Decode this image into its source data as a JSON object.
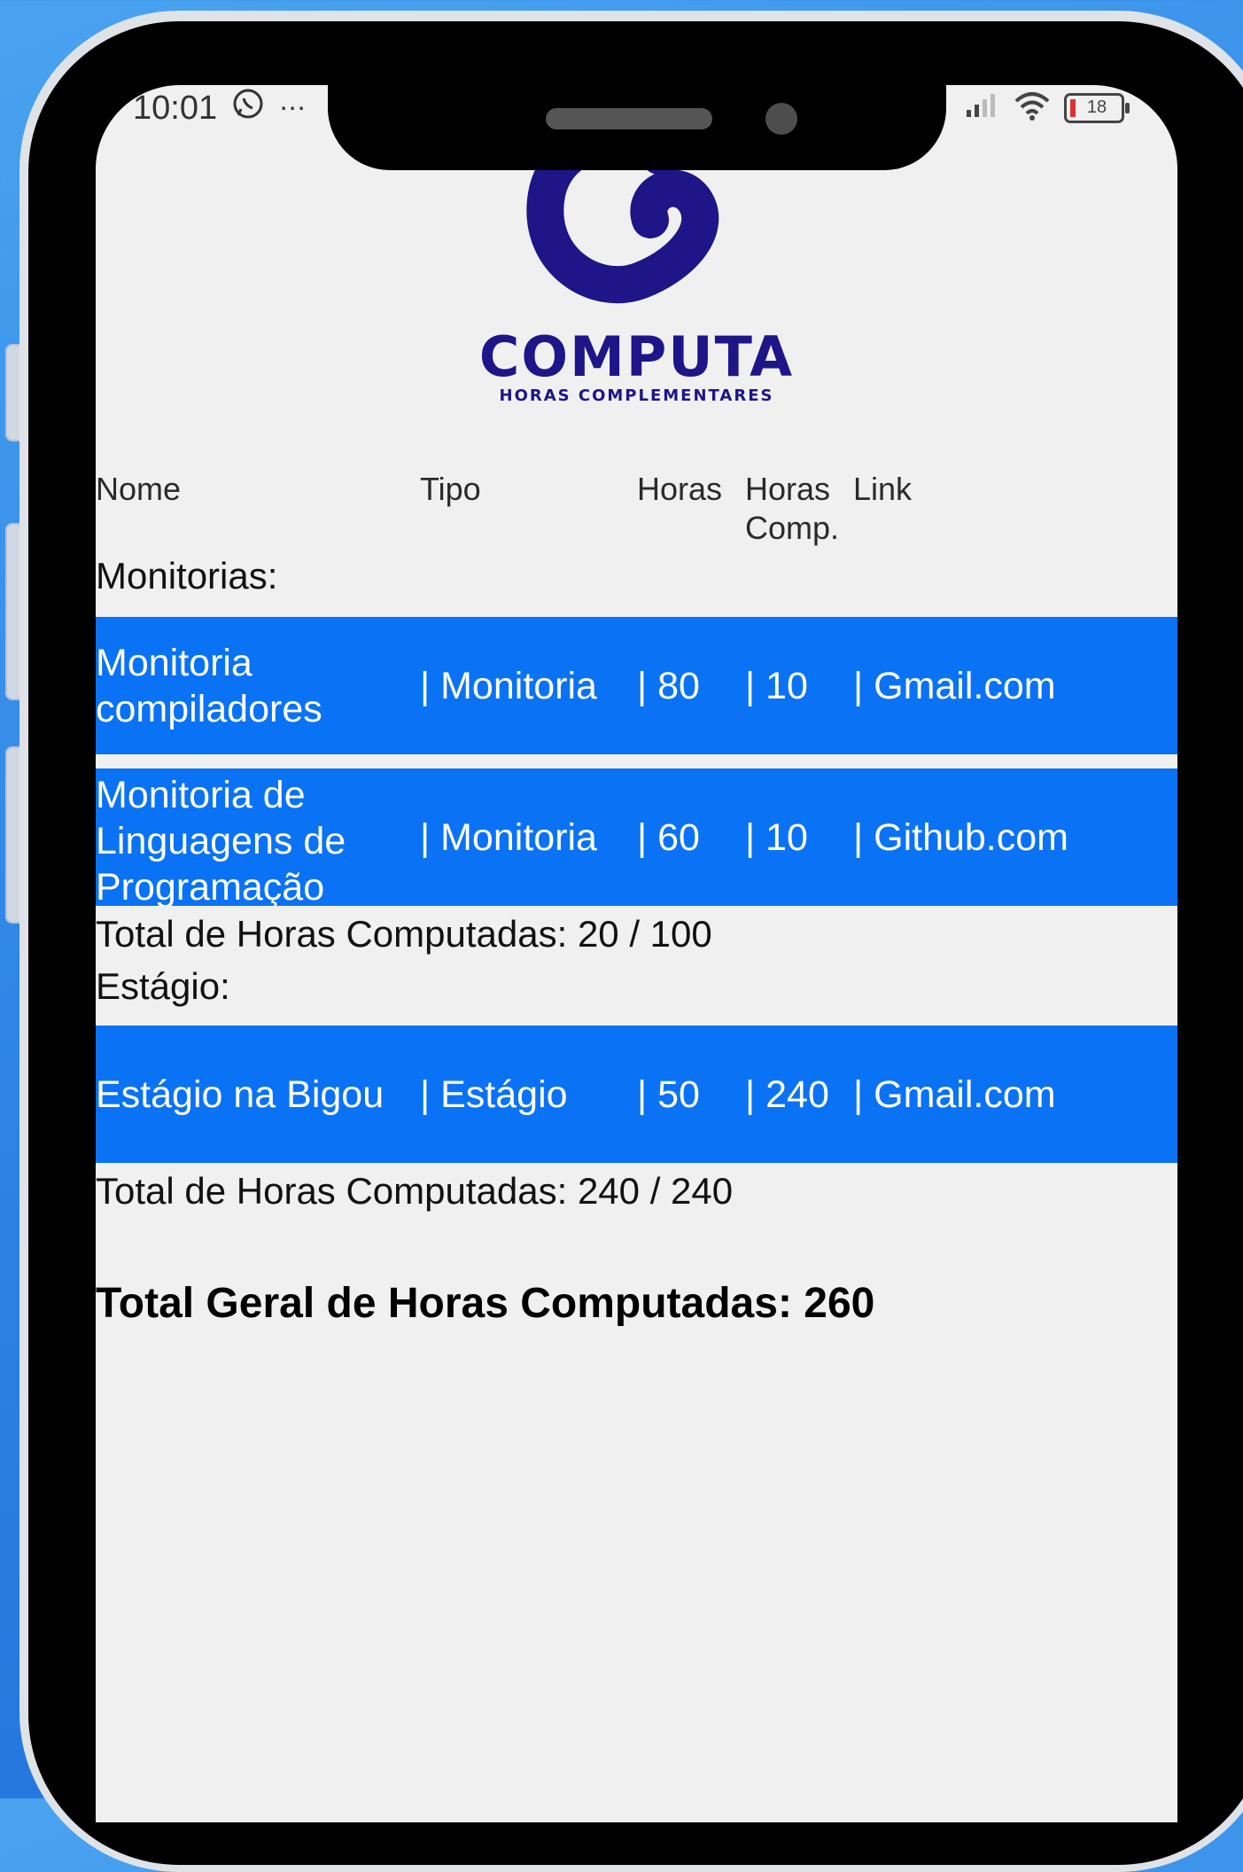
{
  "status_bar": {
    "time": "10:01",
    "battery": "18"
  },
  "brand": {
    "name": "COMPUTA",
    "tagline": "HORAS COMPLEMENTARES"
  },
  "table_header": {
    "nome": "Nome",
    "tipo": "Tipo",
    "horas": "Horas",
    "horas_comp": "Horas Comp.",
    "link": "Link"
  },
  "sections": [
    {
      "title": "Monitorias:",
      "rows": [
        {
          "nome": "Monitoria compiladores",
          "tipo": "| Monitoria",
          "horas": "| 80",
          "horas_comp": "| 10",
          "link": "| Gmail.com"
        },
        {
          "nome": "Monitoria de Linguagens de Programação",
          "tipo": "| Monitoria",
          "horas": "| 60",
          "horas_comp": "| 10",
          "link": "| Github.com"
        }
      ],
      "total": "Total de Horas Computadas: 20 / 100"
    },
    {
      "title": "Estágio:",
      "rows": [
        {
          "nome": "Estágio na Bigou",
          "tipo": "| Estágio",
          "horas": "| 50",
          "horas_comp": "| 240",
          "link": "| Gmail.com"
        }
      ],
      "total": "Total de Horas Computadas: 240 / 240"
    }
  ],
  "grand_total": "Total Geral de Horas Computadas: 260",
  "colors": {
    "row_bg": "#0a72f5",
    "brand": "#1d1588",
    "screen_bg": "#f0f0f0"
  }
}
